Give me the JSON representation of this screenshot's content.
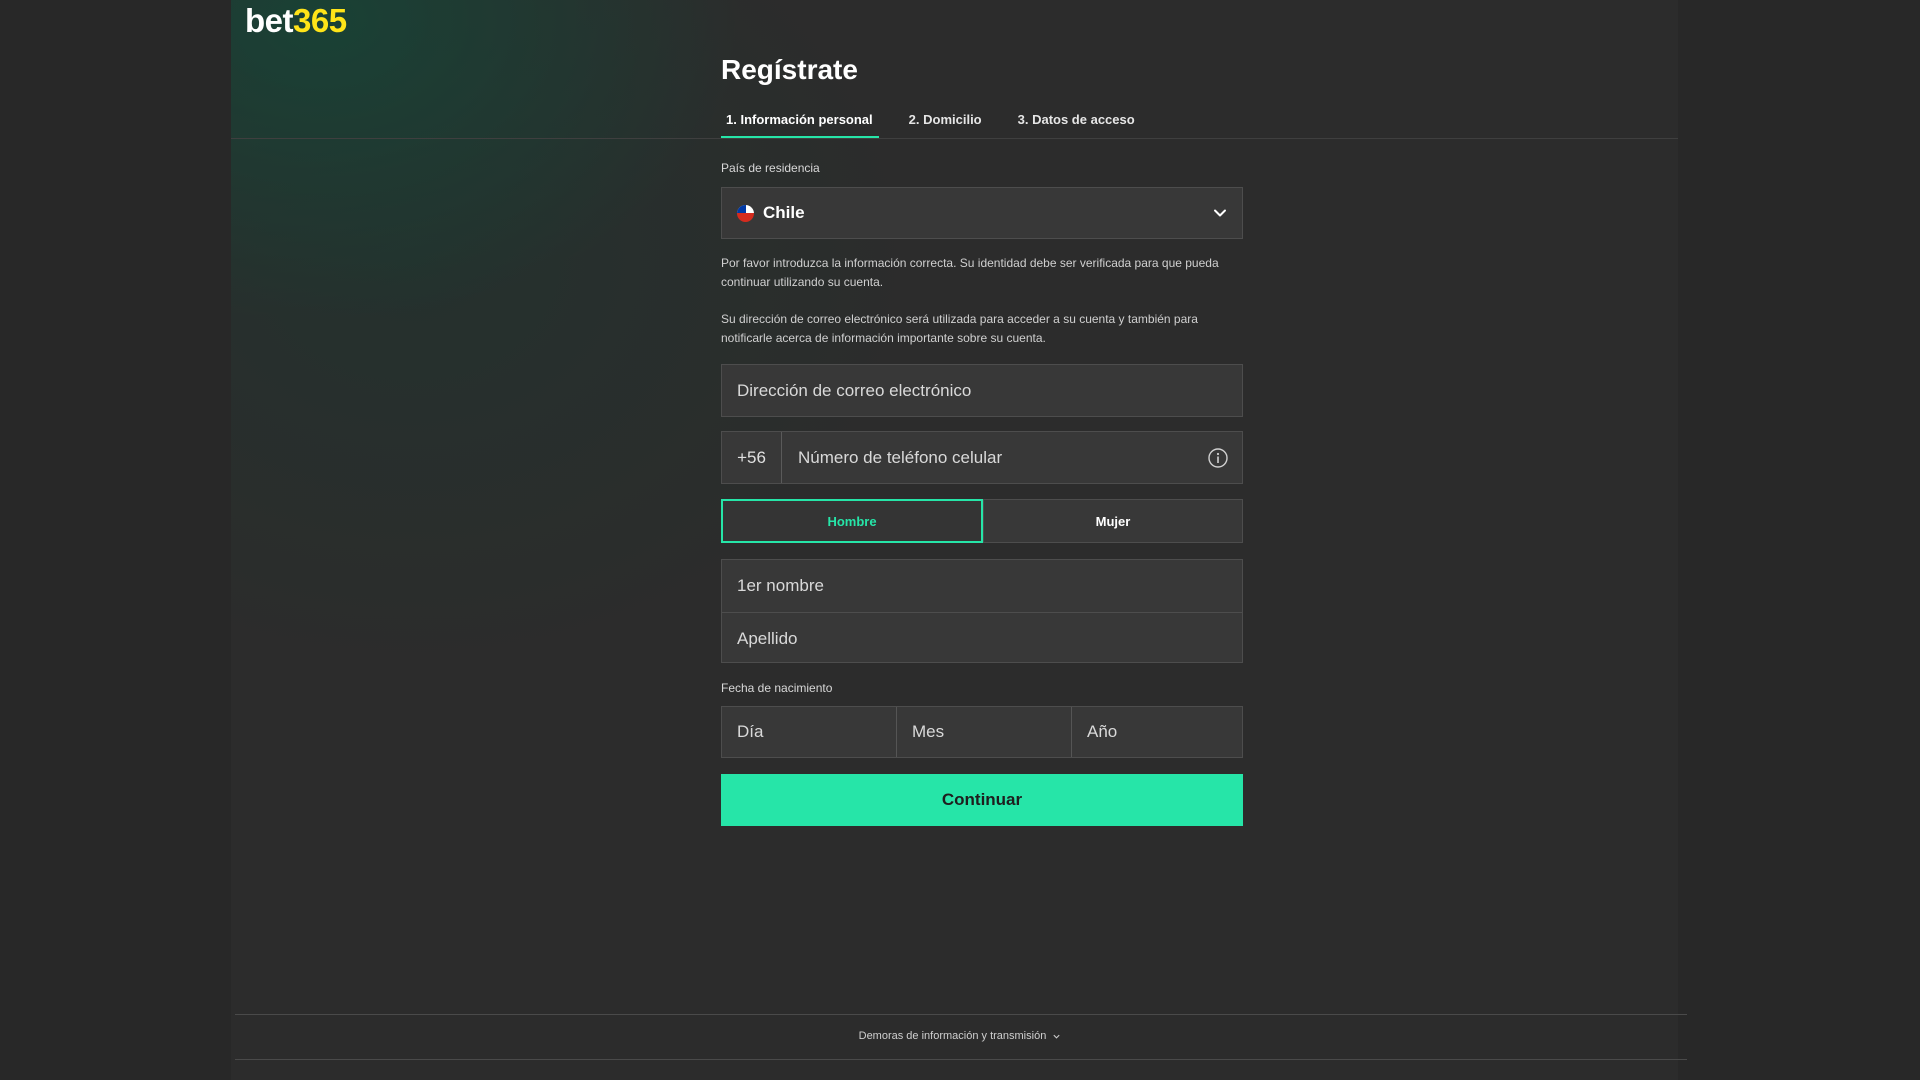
{
  "brand": {
    "part1": "bet",
    "part2": "365",
    "accent": "#ffe418"
  },
  "colors": {
    "accent": "#26e5a8",
    "background": "#2b2b2b",
    "field": "#383838"
  },
  "page": {
    "title": "Regístrate"
  },
  "steps": [
    {
      "label": "1.  Información personal",
      "active": true
    },
    {
      "label": "2.  Domicilio",
      "active": false
    },
    {
      "label": "3.  Datos de acceso",
      "active": false
    }
  ],
  "country": {
    "label": "País de residencia",
    "value": "Chile",
    "flag_icon": "chile-flag-icon",
    "toggle_icon": "chevron-down-icon"
  },
  "notices": {
    "identity": "Por favor introduzca la información correcta. Su identidad debe ser verificada para que pueda continuar utilizando su cuenta.",
    "email": "Su dirección de correo electrónico será utilizada para acceder a su cuenta y también para notificarle acerca de información importante sobre su cuenta."
  },
  "email": {
    "placeholder": "Dirección de correo electrónico",
    "value": ""
  },
  "phone": {
    "prefix": "+56",
    "placeholder": "Número de teléfono celular",
    "value": "",
    "icon": "info-icon"
  },
  "gender": {
    "options": [
      {
        "label": "Hombre",
        "selected": true
      },
      {
        "label": "Mujer",
        "selected": false
      }
    ]
  },
  "name": {
    "first_placeholder": "1er nombre",
    "last_placeholder": "Apellido"
  },
  "dob": {
    "label": "Fecha de nacimiento",
    "day_placeholder": "Día",
    "month_placeholder": "Mes",
    "year_placeholder": "Año"
  },
  "actions": {
    "continue_label": "Continuar"
  },
  "footer": {
    "link_label": "Demoras de información y transmisión",
    "icon": "chevron-down-icon"
  }
}
